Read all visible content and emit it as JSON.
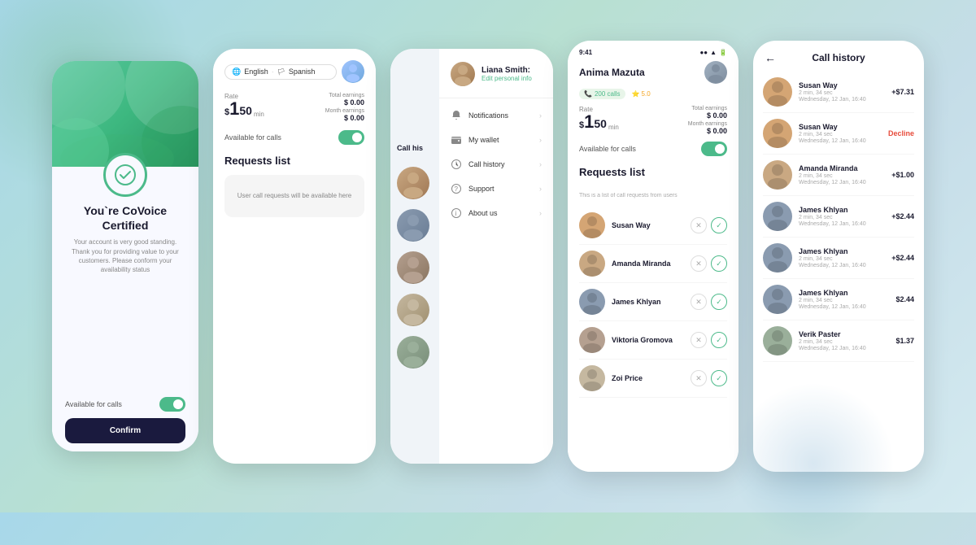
{
  "phone1": {
    "title": "You`re CoVoice Certified",
    "description": "Your account is very good standing. Thank you for providing value to your customers. Please conform your availability status",
    "available_label": "Available for calls",
    "confirm_label": "Confirm"
  },
  "phone2": {
    "lang1": "English",
    "lang2": "Spanish",
    "rate_label": "Rate",
    "rate_dollar": "$",
    "rate_number": "1",
    "rate_sup": "50",
    "rate_min": "min",
    "total_earnings_label": "Total earnings",
    "total_earnings_value": "$ 0.00",
    "month_earnings_label": "Month earnings",
    "month_earnings_value": "$ 0.00",
    "available_label": "Available for calls",
    "requests_title": "Requests list",
    "empty_text": "User call requests will be available here"
  },
  "phone3": {
    "user_name": "Liana Smith:",
    "user_sub": "Edit personal info",
    "call_history": "Call his",
    "menu_items": [
      {
        "label": "Notifications",
        "icon": "bell"
      },
      {
        "label": "My wallet",
        "icon": "wallet"
      },
      {
        "label": "Call history",
        "icon": "clock"
      },
      {
        "label": "Support",
        "icon": "help"
      },
      {
        "label": "About us",
        "icon": "info"
      }
    ],
    "avatars": [
      "av-2",
      "av-3",
      "av-4",
      "av-5",
      "av-6"
    ]
  },
  "phone4": {
    "status_time": "9:41",
    "user_name": "Anima Mazuta",
    "calls_count": "200 calls",
    "rating": "5.0",
    "rate_label": "Rate",
    "rate_dollar": "$",
    "rate_number": "1",
    "rate_sup": "50",
    "rate_min": "min",
    "total_earnings_label": "Total earnings",
    "total_earnings_value": "$ 0.00",
    "month_earnings_label": "Month earnings",
    "month_earnings_value": "$ 0.00",
    "available_label": "Available for calls",
    "requests_title": "Requests list",
    "requests_subtitle": "This is a list of call requests from users",
    "requests": [
      {
        "name": "Susan Way",
        "av": "av-1"
      },
      {
        "name": "Amanda Miranda",
        "av": "av-2"
      },
      {
        "name": "James Khlyan",
        "av": "av-3"
      },
      {
        "name": "Viktoria Gromova",
        "av": "av-4"
      },
      {
        "name": "Zoi Price",
        "av": "av-5"
      }
    ]
  },
  "phone5": {
    "title": "Call history",
    "back": "←",
    "calls": [
      {
        "name": "Susan Way",
        "meta": "2 min, 34 sec",
        "date": "Wednesday, 12 Jan, 16:40",
        "amount": "+$7.31",
        "type": "positive",
        "av": "av-1"
      },
      {
        "name": "Susan Way",
        "meta": "2 min, 34 sec",
        "date": "Wednesday, 12 Jan, 16:40",
        "amount": "Decline",
        "type": "decline",
        "av": "av-1"
      },
      {
        "name": "Amanda Miranda",
        "meta": "2 min, 34 sec",
        "date": "Wednesday, 12 Jan, 16:40",
        "amount": "+$1.00",
        "type": "positive",
        "av": "av-2"
      },
      {
        "name": "James Khlyan",
        "meta": "2 min, 34 sec",
        "date": "Wednesday, 12 Jan, 16:40",
        "amount": "+$2.44",
        "type": "positive",
        "av": "av-3"
      },
      {
        "name": "James Khlyan",
        "meta": "2 min, 34 sec",
        "date": "Wednesday, 12 Jan, 16:40",
        "amount": "+$2.44",
        "type": "positive",
        "av": "av-3"
      },
      {
        "name": "James Khlyan",
        "meta": "2 min, 34 sec",
        "date": "Wednesday, 12 Jan, 16:40",
        "amount": "$2.44",
        "type": "neutral",
        "av": "av-3"
      },
      {
        "name": "Verik Paster",
        "meta": "2 min, 34 sec",
        "date": "Wednesday, 12 Jan, 16:40",
        "amount": "$1.37",
        "type": "neutral",
        "av": "av-6"
      }
    ]
  }
}
